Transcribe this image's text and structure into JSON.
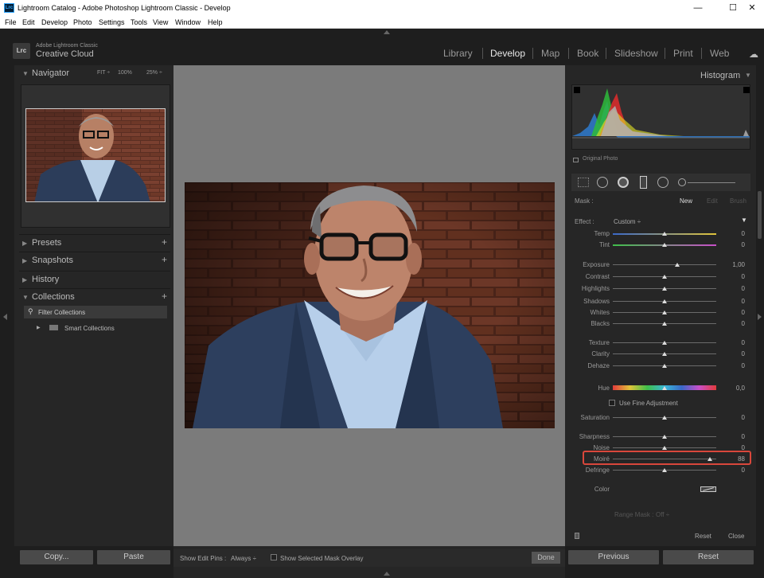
{
  "window": {
    "title": "Lightroom Catalog - Adobe Photoshop Lightroom Classic - Develop",
    "app_badge": "Lrc",
    "minimize": "—",
    "maximize": "☐",
    "close": "✕"
  },
  "menu": [
    "File",
    "Edit",
    "Develop",
    "Photo",
    "Settings",
    "Tools",
    "View",
    "Window",
    "Help"
  ],
  "brand": {
    "badge": "Lrc",
    "sub": "Adobe Lightroom Classic",
    "main": "Creative Cloud"
  },
  "modules": [
    {
      "label": "Library",
      "active": false
    },
    {
      "label": "Develop",
      "active": true
    },
    {
      "label": "Map",
      "active": false
    },
    {
      "label": "Book",
      "active": false
    },
    {
      "label": "Slideshow",
      "active": false
    },
    {
      "label": "Print",
      "active": false
    },
    {
      "label": "Web",
      "active": false
    }
  ],
  "left": {
    "navigator": {
      "label": "Navigator",
      "fit": "FIT ÷",
      "p100": "100%",
      "p25": "25% ÷"
    },
    "presets": "Presets",
    "snapshots": "Snapshots",
    "history": "History",
    "collections": "Collections",
    "filter_collections": "Filter Collections",
    "smart_collections": "Smart Collections",
    "copy_btn": "Copy...",
    "paste_btn": "Paste"
  },
  "toolbar": {
    "show_edit_pins": "Show Edit Pins :",
    "pins_value": "Always ÷",
    "show_mask_overlay": "Show Selected Mask Overlay",
    "done": "Done"
  },
  "right": {
    "histogram": "Histogram",
    "original_photo": "Original Photo",
    "mask_label": "Mask :",
    "mask_new": "New",
    "mask_edit": "Edit",
    "mask_brush": "Brush",
    "effect_label": "Effect :",
    "effect_value": "Custom ÷",
    "sliders": [
      {
        "label": "Temp",
        "value": "0",
        "pos": 0.5,
        "type": "temp"
      },
      {
        "label": "Tint",
        "value": "0",
        "pos": 0.5,
        "type": "tint"
      },
      {
        "label": "Exposure",
        "value": "1,00",
        "pos": 0.625,
        "type": "plain"
      },
      {
        "label": "Contrast",
        "value": "0",
        "pos": 0.5,
        "type": "plain"
      },
      {
        "label": "Highlights",
        "value": "0",
        "pos": 0.5,
        "type": "plain"
      },
      {
        "label": "Shadows",
        "value": "0",
        "pos": 0.5,
        "type": "plain"
      },
      {
        "label": "Whites",
        "value": "0",
        "pos": 0.5,
        "type": "plain"
      },
      {
        "label": "Blacks",
        "value": "0",
        "pos": 0.5,
        "type": "plain"
      },
      {
        "label": "Texture",
        "value": "0",
        "pos": 0.5,
        "type": "plain"
      },
      {
        "label": "Clarity",
        "value": "0",
        "pos": 0.5,
        "type": "plain"
      },
      {
        "label": "Dehaze",
        "value": "0",
        "pos": 0.5,
        "type": "plain"
      },
      {
        "label": "Hue",
        "value": "0,0",
        "pos": 0.5,
        "type": "hue"
      },
      {
        "label": "Saturation",
        "value": "0",
        "pos": 0.5,
        "type": "plain"
      },
      {
        "label": "Sharpness",
        "value": "0",
        "pos": 0.5,
        "type": "plain"
      },
      {
        "label": "Noise",
        "value": "0",
        "pos": 0.5,
        "type": "plain"
      },
      {
        "label": "Moiré",
        "value": "88",
        "pos": 0.94,
        "type": "plain"
      },
      {
        "label": "Defringe",
        "value": "0",
        "pos": 0.5,
        "type": "plain"
      }
    ],
    "use_fine_adjustment": "Use Fine Adjustment",
    "color_label": "Color",
    "range_mask": "Range Mask :",
    "range_mask_value": "Off ÷",
    "reset": "Reset",
    "close": "Close",
    "previous_btn": "Previous",
    "reset_btn": "Reset"
  },
  "colors": {
    "highlight": "#d9473b",
    "panel": "#262626",
    "canvas": "#7b7b7b"
  }
}
